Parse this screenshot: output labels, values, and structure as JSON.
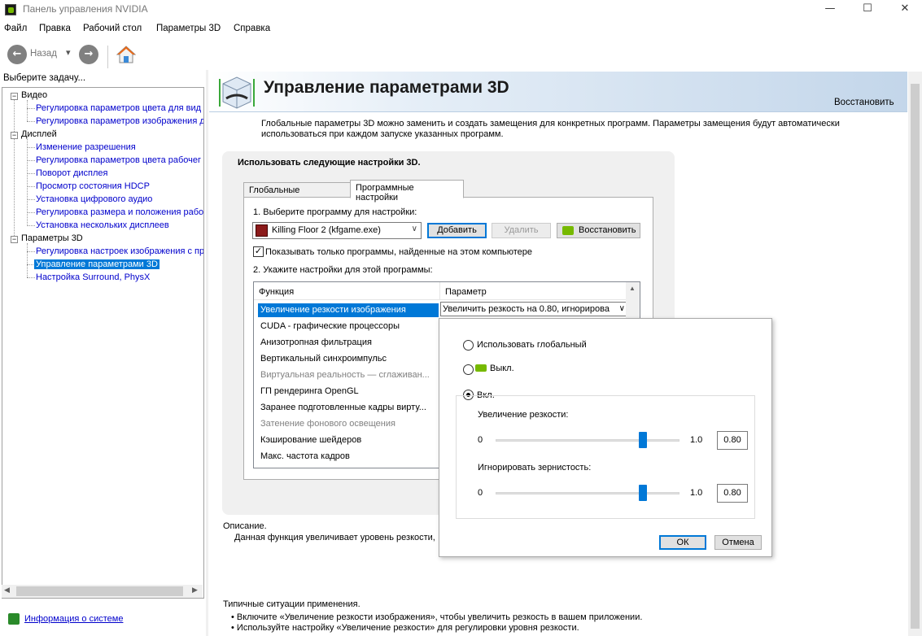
{
  "window": {
    "title": "Панель управления NVIDIA",
    "minimize": "—",
    "maximize": "☐",
    "close": "✕"
  },
  "menu": [
    "Файл",
    "Правка",
    "Рабочий стол",
    "Параметры 3D",
    "Справка"
  ],
  "toolbar": {
    "back_label": "Назад",
    "back_glyph": "←",
    "forward_glyph": "→",
    "dropdown_glyph": "▾"
  },
  "sidebar": {
    "header": "Выберите задачу...",
    "categories": [
      {
        "label": "Видео",
        "items": [
          "Регулировка параметров цвета для вид",
          "Регулировка параметров изображения д"
        ]
      },
      {
        "label": "Дисплей",
        "items": [
          "Изменение разрешения",
          "Регулировка параметров цвета рабочег",
          "Поворот дисплея",
          "Просмотр состояния HDCP",
          "Установка цифрового аудио",
          "Регулировка размера и положения рабо",
          "Установка нескольких дисплеев"
        ]
      },
      {
        "label": "Параметры 3D",
        "items": [
          "Регулировка настроек изображения с пр",
          "Управление параметрами 3D",
          "Настройка Surround, PhysX"
        ]
      }
    ],
    "expander_glyph": "−",
    "system_info": "Информация о системе"
  },
  "page": {
    "title": "Управление параметрами 3D",
    "restore": "Восстановить",
    "intro": "Глобальные параметры 3D можно заменить и создать замещения для конкретных программ. Параметры замещения будут автоматически использоваться при каждом запуске указанных программ.",
    "panel_title": "Использовать следующие настройки 3D.",
    "tabs": [
      "Глобальные параметры",
      "Программные настройки"
    ],
    "step1": "1. Выберите программу для настройки:",
    "program": "Killing Floor 2 (kfgame.exe)",
    "select_glyph": "∨",
    "add": "Добавить",
    "remove": "Удалить",
    "restore_btn": "Восстановить",
    "only_found": "Показывать только программы, найденные на этом компьютере",
    "only_found_checked": true,
    "check_glyph": "✓",
    "step2": "2. Укажите настройки для этой программы:",
    "table": {
      "headers": [
        "Функция",
        "Параметр"
      ],
      "rows": [
        {
          "name": "Увеличение резкости изображения",
          "state": "selected"
        },
        {
          "name": "CUDA - графические процессоры",
          "state": "normal"
        },
        {
          "name": "Анизотропная фильтрация",
          "state": "normal"
        },
        {
          "name": "Вертикальный синхроимпульс",
          "state": "normal"
        },
        {
          "name": "Виртуальная реальность — сглаживан...",
          "state": "dim"
        },
        {
          "name": "ГП рендеринга OpenGL",
          "state": "normal"
        },
        {
          "name": "Заранее подготовленные кадры вирту...",
          "state": "normal"
        },
        {
          "name": "Затенение фонового освещения",
          "state": "dim"
        },
        {
          "name": "Кэширование шейдеров",
          "state": "normal"
        },
        {
          "name": "Макс. частота кадров",
          "state": "normal"
        }
      ],
      "param_value": "Увеличить резкость на 0.80, игнорирова",
      "scroll_up": "▲"
    },
    "description_label": "Описание.",
    "description": "Данная функция увеличивает уровень резкости,",
    "usage_label": "Типичные ситуации применения.",
    "usage_items": [
      "• Включите «Увеличение резкости изображения», чтобы увеличить резкость в вашем приложении.",
      "• Используйте настройку «Увеличение резкости» для регулировки уровня резкости."
    ]
  },
  "popup": {
    "use_global": "Использовать глобальный",
    "off": "Выкл.",
    "on": "Вкл.",
    "selected_option": "on",
    "sharpen": {
      "label": "Увеличение резкости:",
      "min": "0",
      "max": "1.0",
      "value": "0.80",
      "fraction": 0.8
    },
    "grain": {
      "label": "Игнорировать зернистость:",
      "min": "0",
      "max": "1.0",
      "value": "0.80",
      "fraction": 0.8
    },
    "ok": "ОК",
    "cancel": "Отмена"
  },
  "colors": {
    "accent": "#0078d7",
    "nvidia_green": "#76b900",
    "link": "#0000cc"
  }
}
